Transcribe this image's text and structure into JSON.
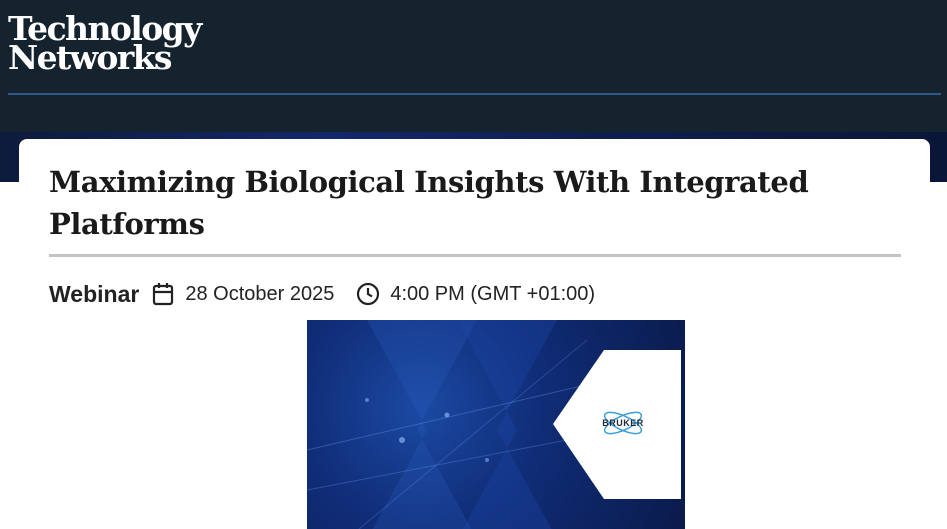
{
  "site": {
    "logo_line1": "Technology",
    "logo_line2": "Networks"
  },
  "event": {
    "title": "Maximizing Biological Insights With Integrated Platforms",
    "type": "Webinar",
    "date": "28 October 2025",
    "time": "4:00 PM (GMT +01:00)"
  },
  "banner": {
    "sponsor_logo_text": "BRUKER"
  },
  "icons": {
    "date": "calendar-icon",
    "time": "clock-icon"
  },
  "colors": {
    "header_bg": "#15232f",
    "header_rule": "#2d5a8c",
    "banner_blue": "#102d78",
    "text_primary": "#1a1a1a"
  }
}
